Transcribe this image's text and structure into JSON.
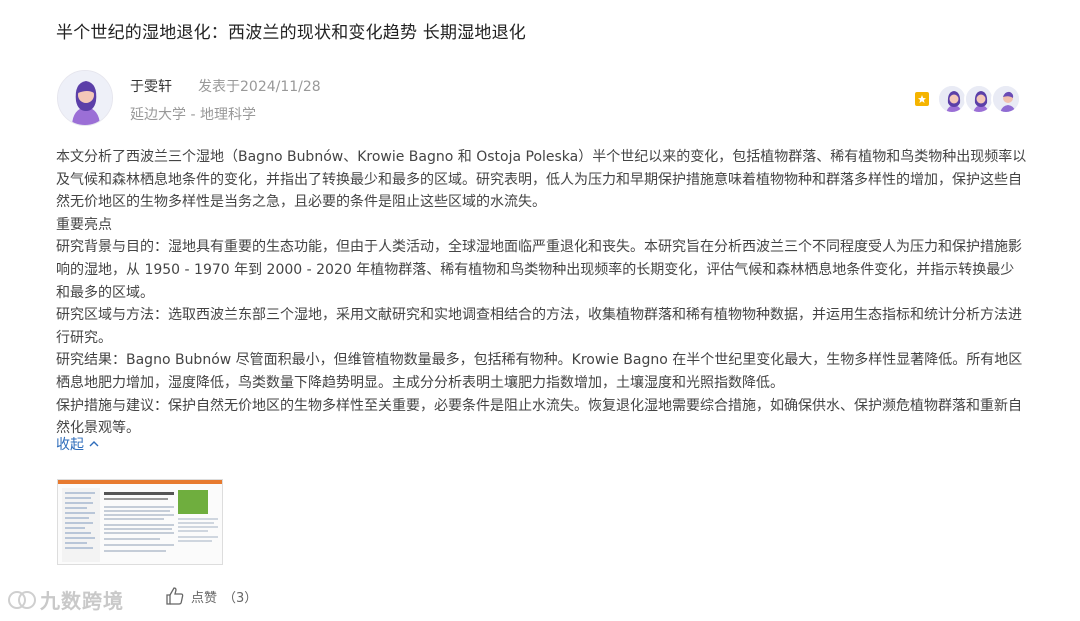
{
  "post": {
    "title": "半个世纪的湿地退化：西波兰的现状和变化趋势 长期湿地退化",
    "author": "于雯轩",
    "posted": "发表于2024/11/28",
    "affiliation": "延边大学 - 地理科学"
  },
  "content": {
    "paragraphs": [
      "本文分析了西波兰三个湿地（Bagno Bubnów、Krowie Bagno 和 Ostoja Poleska）半个世纪以来的变化，包括植物群落、稀有植物和鸟类物种出现频率以及气候和森林栖息地条件的变化，并指出了转换最少和最多的区域。研究表明，低人为压力和早期保护措施意味着植物物种和群落多样性的增加，保护这些自然无价地区的生物多样性是当务之急，且必要的条件是阻止这些区域的水流失。",
      "重要亮点",
      "研究背景与目的：湿地具有重要的生态功能，但由于人类活动，全球湿地面临严重退化和丧失。本研究旨在分析西波兰三个不同程度受人为压力和保护措施影响的湿地，从 1950 - 1970 年到 2000 - 2020 年植物群落、稀有植物和鸟类物种出现频率的长期变化，评估气候和森林栖息地条件变化，并指示转换最少和最多的区域。",
      "研究区域与方法：选取西波兰东部三个湿地，采用文献研究和实地调查相结合的方法，收集植物群落和稀有植物物种数据，并运用生态指标和统计分析方法进行研究。",
      "研究结果：Bagno Bubnów 尽管面积最小，但维管植物数量最多，包括稀有物种。Krowie Bagno 在半个世纪里变化最大，生物多样性显著降低。所有地区栖息地肥力增加，湿度降低，鸟类数量下降趋势明显。主成分分析表明土壤肥力指数增加，土壤湿度和光照指数降低。",
      "保护措施与建议：保护自然无价地区的生物多样性至关重要，必要条件是阻止水流失。恢复退化湿地需要综合措施，如确保供水、保护濒危植物群落和重新自然化景观等。"
    ],
    "collapse_label": "收起"
  },
  "footer": {
    "watermark": "九数跨境",
    "like_label": "点赞",
    "like_count": "（3）"
  }
}
